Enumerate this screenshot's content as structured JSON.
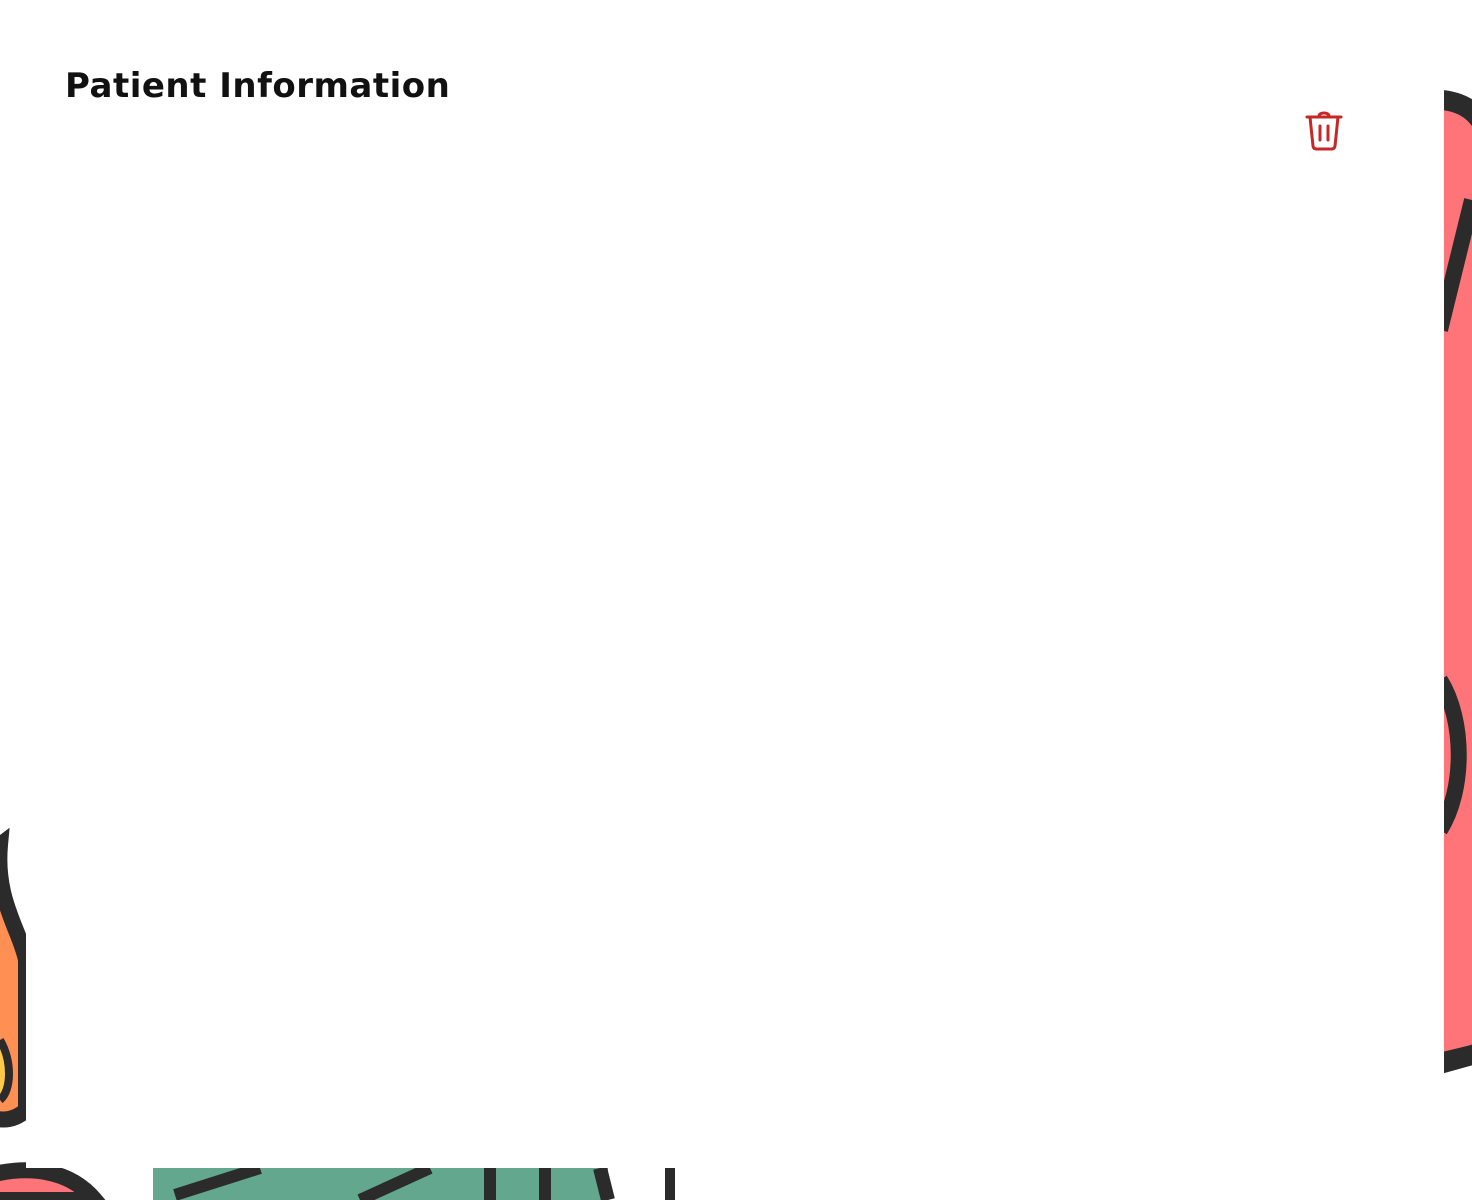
{
  "header": {
    "title": "Patient Information"
  },
  "actions": {
    "delete_icon": "trash-icon"
  },
  "colors": {
    "delete_accent": "#c62828",
    "art_pink": "#ff7479",
    "art_orange": "#ff8f52",
    "art_yellow": "#ffc94a",
    "art_green": "#62a78e",
    "art_outline": "#2b2b2b"
  }
}
